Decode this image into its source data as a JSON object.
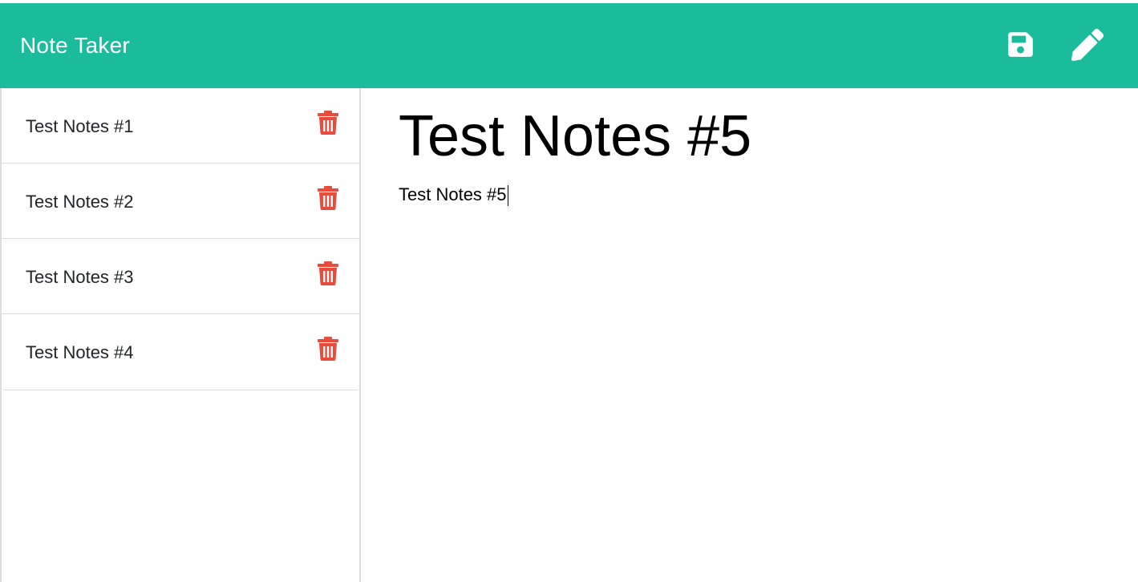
{
  "app": {
    "brand": "Note Taker"
  },
  "colors": {
    "navbar": "#1abc9c",
    "delete": "#e74c3c",
    "icon": "#ffffff"
  },
  "toolbar": {
    "save_icon": "save-icon",
    "new_note_icon": "pencil-icon"
  },
  "sidebar": {
    "notes": [
      {
        "title": "Test Notes #1",
        "delete_icon": "trash-icon"
      },
      {
        "title": "Test Notes #2",
        "delete_icon": "trash-icon"
      },
      {
        "title": "Test Notes #3",
        "delete_icon": "trash-icon"
      },
      {
        "title": "Test Notes #4",
        "delete_icon": "trash-icon"
      }
    ]
  },
  "editor": {
    "title_value": "Test Notes #5",
    "text_value": "Test Notes #5"
  }
}
